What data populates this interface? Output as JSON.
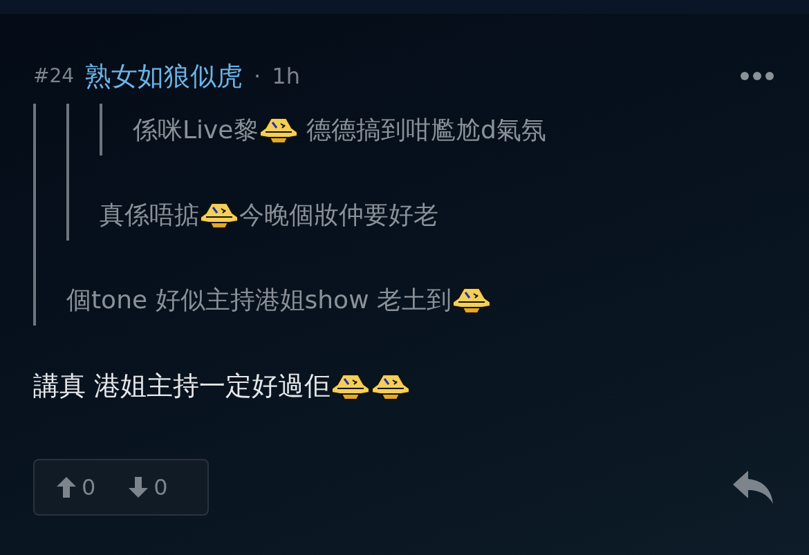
{
  "post": {
    "number": "#24",
    "author": "熟女如狼似虎",
    "separator": "·",
    "time": "1h",
    "quote": {
      "quote": {
        "quote": {
          "parts": [
            {
              "kind": "text",
              "text": "係咪Live黎"
            },
            {
              "kind": "emoji"
            },
            {
              "kind": "text",
              "text": " 德德搞到咁尷尬d氣氛"
            }
          ]
        },
        "parts": [
          {
            "kind": "text",
            "text": "真係唔掂"
          },
          {
            "kind": "emoji"
          },
          {
            "kind": "text",
            "text": "今晚個妝仲要好老"
          }
        ]
      },
      "parts": [
        {
          "kind": "text",
          "text": "個tone 好似主持港姐show 老土到"
        },
        {
          "kind": "emoji"
        }
      ]
    },
    "parts": [
      {
        "kind": "text",
        "text": "講真 港姐主持一定好過佢"
      },
      {
        "kind": "emoji"
      },
      {
        "kind": "emoji"
      }
    ],
    "votes": {
      "up": "0",
      "down": "0"
    }
  }
}
